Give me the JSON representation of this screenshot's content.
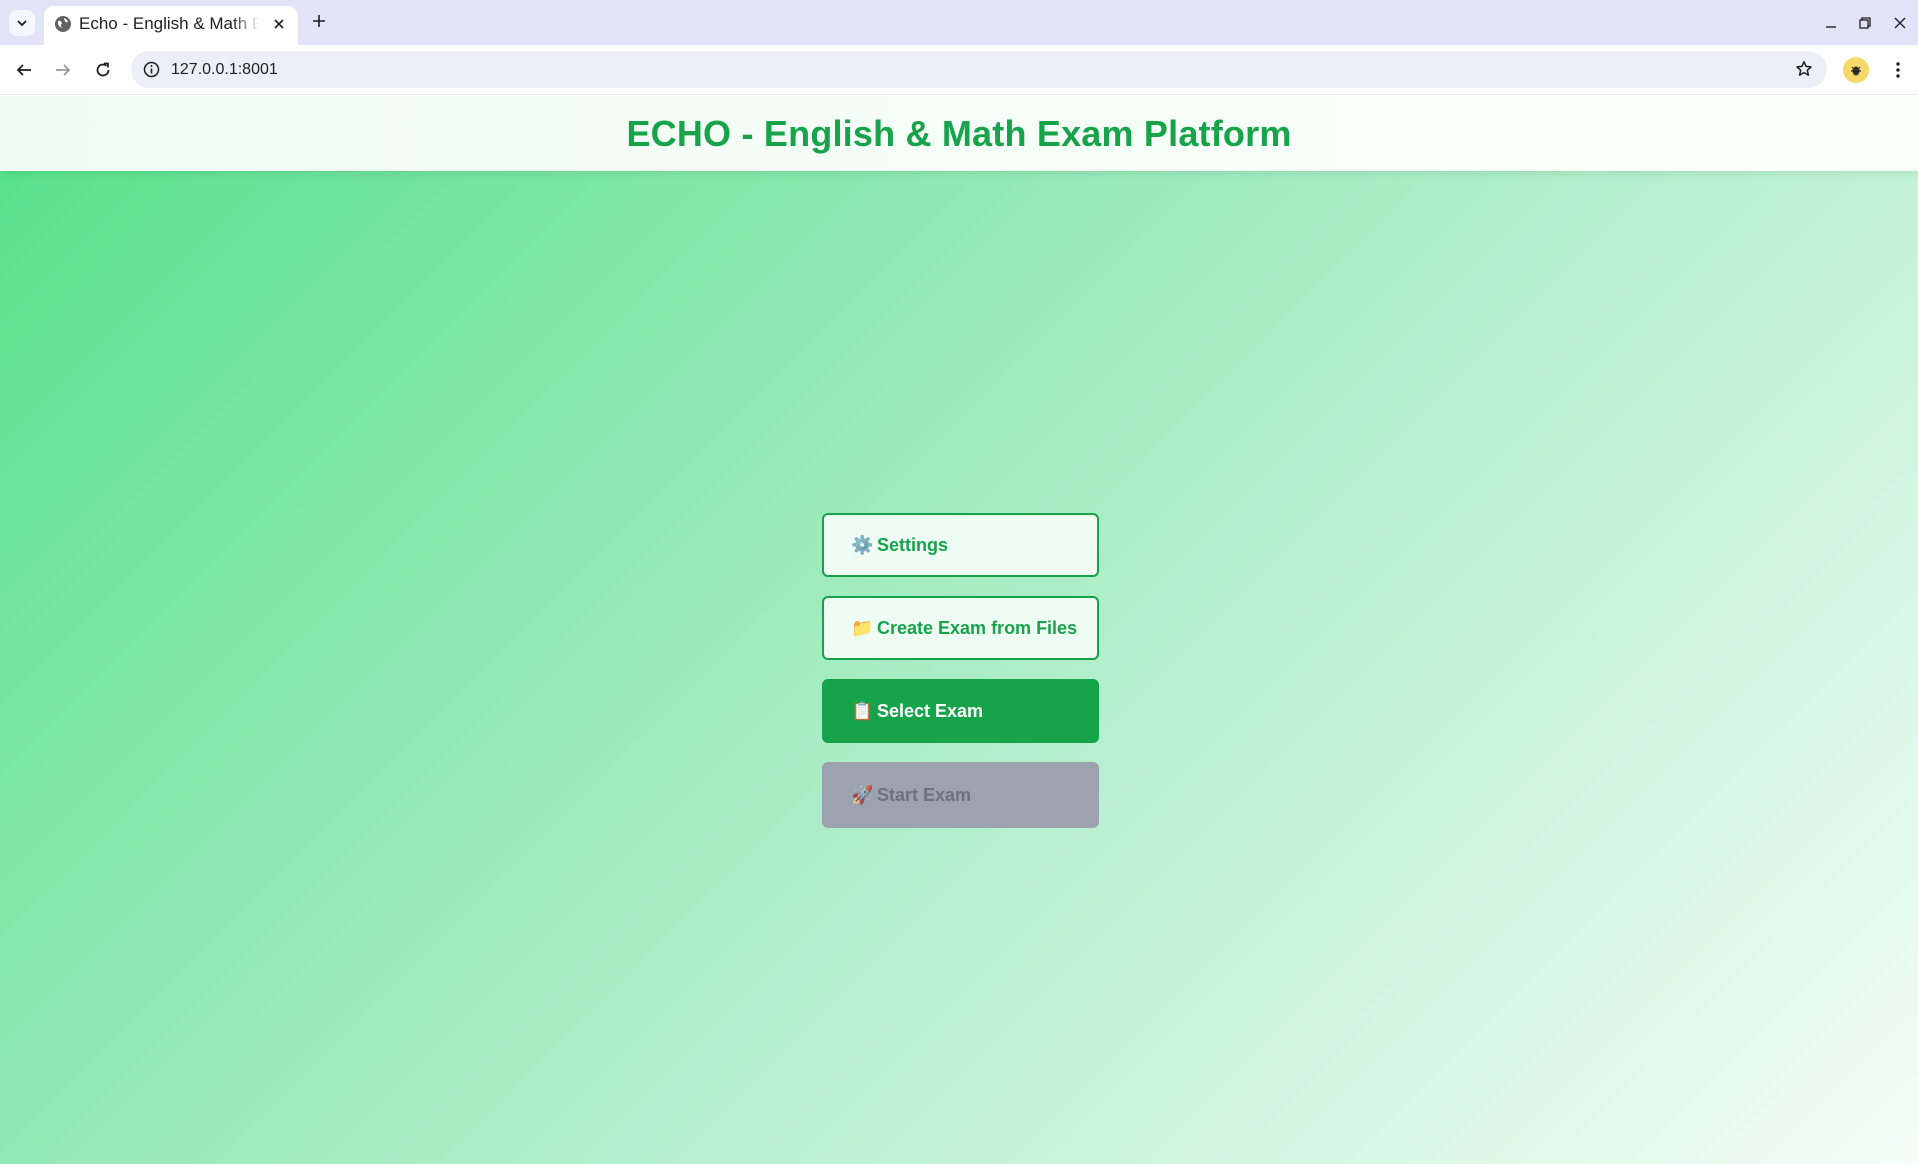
{
  "browser": {
    "tab": {
      "title": "Echo - English & Math Exam Platform",
      "favicon": "globe-icon"
    },
    "url": "127.0.0.1:8001",
    "icons": [
      "tab-list-icon",
      "globe-icon",
      "close-icon",
      "plus-icon",
      "minimize-icon",
      "restore-icon",
      "window-close-icon",
      "back-arrow-icon",
      "forward-arrow-icon",
      "reload-icon",
      "info-icon",
      "star-icon",
      "extension-icon",
      "kebab-menu-icon"
    ]
  },
  "page": {
    "title": "ECHO - English & Math Exam Platform",
    "menu": [
      {
        "icon": "⚙️",
        "icon_name": "gear-icon",
        "label": "Settings",
        "state": "outline"
      },
      {
        "icon": "📁",
        "icon_name": "folder-icon",
        "label": "Create Exam from Files",
        "state": "outline"
      },
      {
        "icon": "📋",
        "icon_name": "clipboard-icon",
        "label": "Select Exam",
        "state": "primary"
      },
      {
        "icon": "🚀",
        "icon_name": "rocket-icon",
        "label": "Start Exam",
        "state": "disabled"
      }
    ]
  },
  "colors": {
    "accent": "#16a34a",
    "disabled": "#9ca3af",
    "outline_bg": "#effcf4",
    "gradient_start": "#55e088",
    "gradient_end": "#f4fdf7"
  }
}
